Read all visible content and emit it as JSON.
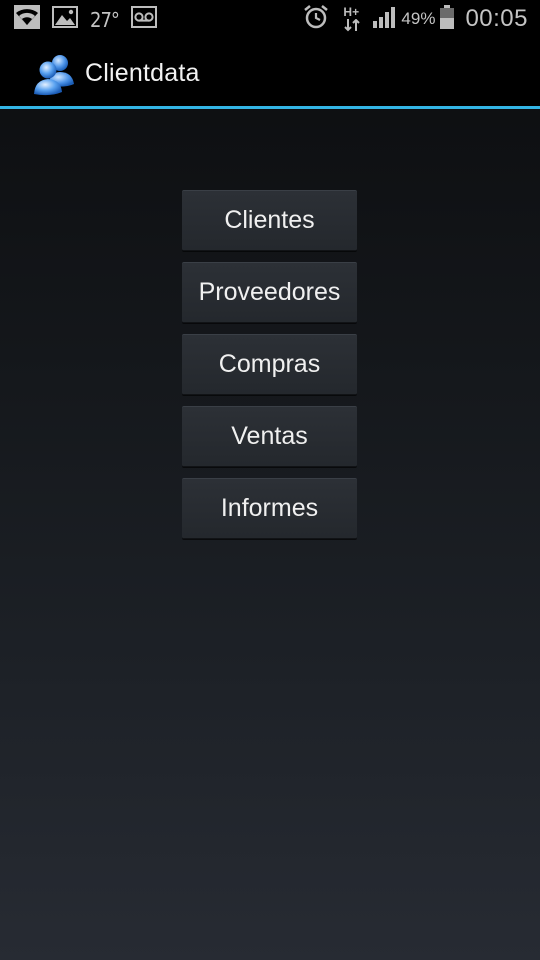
{
  "status_bar": {
    "icons": [
      "wifi-icon",
      "image-notification-icon",
      "voicemail-icon",
      "alarm-icon",
      "hplus-data-icon",
      "signal-icon",
      "battery-icon"
    ],
    "temperature": "27°",
    "network_type": "H+",
    "battery_percent": "49%",
    "time": "00:05"
  },
  "action_bar": {
    "icon": "users-app-icon",
    "title": "Clientdata",
    "accent_color": "#33b5e5"
  },
  "menu": {
    "buttons": [
      {
        "label": "Clientes"
      },
      {
        "label": "Proveedores"
      },
      {
        "label": "Compras"
      },
      {
        "label": "Ventas"
      },
      {
        "label": "Informes"
      }
    ]
  }
}
